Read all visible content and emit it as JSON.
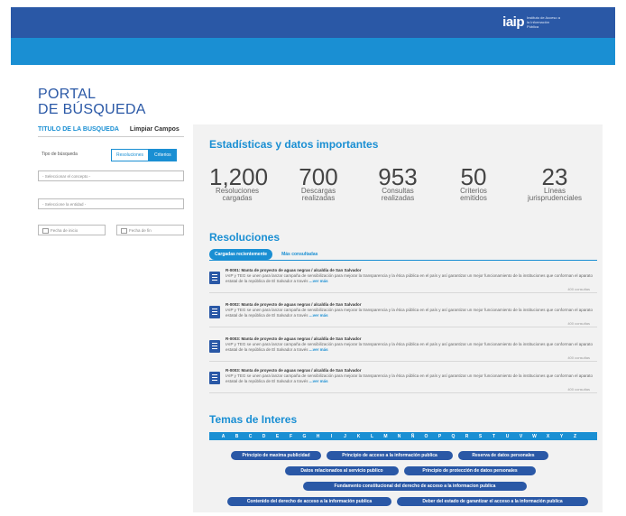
{
  "header": {
    "logo_mark": "iaip",
    "logo_sub": "Instituto de Acceso a la Información Pública"
  },
  "sidebar": {
    "title_line1": "PORTAL",
    "title_line2": "DE BÚSQUEDA",
    "tab_titulo": "TITULO DE LA BUSQUEDA",
    "tab_limpiar": "Limpiar Campos",
    "tipo_label": "Tipo de búsqueda",
    "toggle_resoluciones": "Resoluciones",
    "toggle_criterios": "Criterios",
    "concepto_placeholder": "Seleccionar el concepto",
    "entidad_placeholder": "Seleccione la entidad",
    "fecha_inicio": "Fecha de inicio",
    "fecha_fin": "Fecha de fin"
  },
  "stats": {
    "title": "Estadísticas y datos importantes",
    "items": [
      {
        "value": "1,200",
        "label1": "Resoluciones",
        "label2": "cargadas"
      },
      {
        "value": "700",
        "label1": "Descargas",
        "label2": "realizadas"
      },
      {
        "value": "953",
        "label1": "Consultas",
        "label2": "realizadas"
      },
      {
        "value": "50",
        "label1": "Criterios",
        "label2": "emitidos"
      },
      {
        "value": "23",
        "label1": "Líneas",
        "label2": "jurisprudenciales"
      }
    ]
  },
  "resoluciones": {
    "title": "Resoluciones",
    "tab_active": "Cargadas recientemente",
    "tab_other": "Más consultadas",
    "more_label": "...ver más",
    "items": [
      {
        "title": "R-0001: Manta de proyecto de aguas negras / alcaldía de San Salvador",
        "desc": "IAIP y TEG se unen para lanzar campaña de sensibilización para mejorar la transparencia y la ética pública en el país y así garantizar un mejor funcionamiento de la instituciones que conforman el aparato estatal de la república de El Salvador a través",
        "count": "400 consultas"
      },
      {
        "title": "R-0002: Manta de proyecto de aguas negras / alcaldía de San Salvador",
        "desc": "IAIP y TEG se unen para lanzar campaña de sensibilización para mejorar la transparencia y la ética pública en el país y así garantizar un mejor funcionamiento de la instituciones que conforman el aparato estatal de la república de El Salvador a través",
        "count": "400 consultas"
      },
      {
        "title": "R-0003: Manta de proyecto de aguas negras / alcaldía de San Salvador",
        "desc": "IAIP y TEG se unen para lanzar campaña de sensibilización para mejorar la transparencia y la ética pública en el país y así garantizar un mejor funcionamiento de la instituciones que conforman el aparato estatal de la república de El Salvador a través",
        "count": "400 consultas"
      },
      {
        "title": "R-0003: Manta de proyecto de aguas negras / alcaldía de San Salvador",
        "desc": "IAIP y TEG se unen para lanzar campaña de sensibilización para mejorar la transparencia y la ética pública en el país y así garantizar un mejor funcionamiento de la instituciones que conforman el aparato estatal de la república de El Salvador a través",
        "count": "400 consultas"
      }
    ]
  },
  "temas": {
    "title": "Temas de Interes",
    "letters": [
      "A",
      "B",
      "C",
      "D",
      "E",
      "F",
      "G",
      "H",
      "I",
      "J",
      "K",
      "L",
      "M",
      "N",
      "Ñ",
      "O",
      "P",
      "Q",
      "R",
      "S",
      "T",
      "U",
      "V",
      "W",
      "X",
      "Y",
      "Z"
    ],
    "pills": [
      "Principio de maxima publicidad",
      "Principio de acceso a la información publica",
      "Reserva de datos personales",
      "Datos relacionados al servicio publico",
      "Principio de protección de datos personales",
      "Fundamento constitucional del derecho de acceso a la informacion publica",
      "Contenido  del derecho de acceso a la información publica",
      "Deber del estado de garantizar el acceso a la información publica"
    ]
  }
}
